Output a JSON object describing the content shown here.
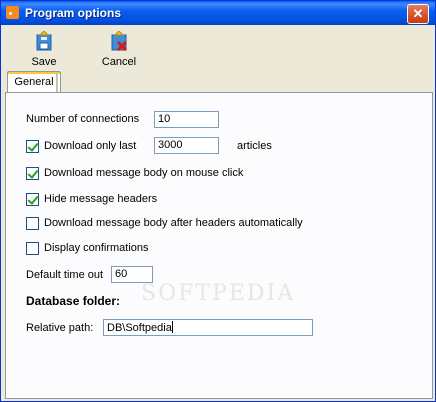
{
  "window": {
    "title": "Program options"
  },
  "toolbar": {
    "save_label": "Save",
    "cancel_label": "Cancel"
  },
  "tabs": [
    {
      "label": "General"
    }
  ],
  "watermark": "SOFTPEDIA",
  "form": {
    "connections_label": "Number of connections",
    "connections_value": "10",
    "download_only_last_label": "Download only last",
    "download_only_last_value": "3000",
    "download_only_last_checked": true,
    "articles_label": "articles",
    "download_body_on_click_label": "Download message body on mouse click",
    "download_body_on_click_checked": true,
    "hide_headers_label": "Hide message headers",
    "hide_headers_checked": true,
    "download_body_after_headers_label": "Download message body after headers automatically",
    "download_body_after_headers_checked": false,
    "display_confirmations_label": "Display confirmations",
    "display_confirmations_checked": false,
    "default_timeout_label": "Default time out",
    "default_timeout_value": "60",
    "database_folder_heading": "Database folder:",
    "relative_path_label": "Relative path:",
    "relative_path_value": "DB\\Softpedia"
  }
}
